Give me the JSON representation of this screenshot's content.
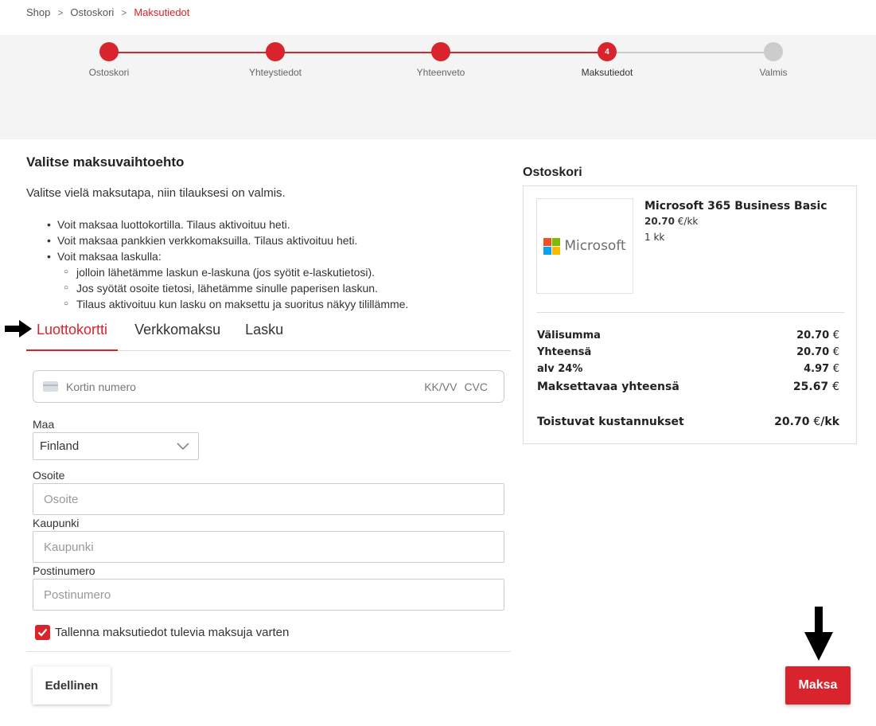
{
  "breadcrumb": {
    "items": [
      "Shop",
      "Ostoskori"
    ],
    "current": "Maksutiedot"
  },
  "colors": {
    "accent": "#d9232d",
    "inactive": "#cccccc"
  },
  "stepper": {
    "steps": [
      {
        "label": "Ostoskori",
        "state": "done"
      },
      {
        "label": "Yhteystiedot",
        "state": "done"
      },
      {
        "label": "Yhteenveto",
        "state": "done"
      },
      {
        "label": "Maksutiedot",
        "state": "current",
        "number": "4"
      },
      {
        "label": "Valmis",
        "state": "todo"
      }
    ]
  },
  "main": {
    "title": "Valitse maksuvaihtoehto",
    "intro": "Valitse vielä maksutapa, niin tilauksesi on valmis.",
    "bullets": [
      "Voit maksaa luottokortilla. Tilaus aktivoituu heti.",
      "Voit maksaa pankkien verkkomaksuilla. Tilaus aktivoituu heti.",
      "Voit maksaa laskulla:"
    ],
    "sub_bullets": [
      "jolloin lähetämme laskun e-laskuna (jos syötit e-laskutietosi).",
      "Jos syötät osoite tietosi, lähetämme sinulle paperisen laskun.",
      "Tilaus aktivoituu kun lasku on maksettu ja suoritus näkyy tilillämme."
    ],
    "tabs": [
      "Luottokortti",
      "Verkkomaksu",
      "Lasku"
    ],
    "active_tab": 0
  },
  "form": {
    "card_placeholder": "Kortin numero",
    "expiry_placeholder": "KK/VV",
    "cvc_placeholder": "CVC",
    "country_label": "Maa",
    "country_value": "Finland",
    "address_label": "Osoite",
    "address_placeholder": "Osoite",
    "city_label": "Kaupunki",
    "city_placeholder": "Kaupunki",
    "zip_label": "Postinumero",
    "zip_placeholder": "Postinumero",
    "save_label": "Tallenna maksutiedot tulevia maksuja varten",
    "save_checked": true
  },
  "actions": {
    "prev_label": "Edellinen",
    "pay_label": "Maksa"
  },
  "cart": {
    "title": "Ostoskori",
    "product_logo_text": "Microsoft",
    "product_name": "Microsoft 365 Business Basic",
    "product_price": "20.70",
    "product_price_unit": "€/kk",
    "product_qty": "1 kk",
    "totals": [
      {
        "label": "Välisumma",
        "value": "20.70",
        "unit": "€"
      },
      {
        "label": "Yhteensä",
        "value": "20.70",
        "unit": "€"
      },
      {
        "label": "alv 24%",
        "value": "4.97",
        "unit": "€"
      },
      {
        "label": "Maksettavaa yhteensä",
        "value": "25.67",
        "unit": "€"
      }
    ],
    "recurring_label": "Toistuvat kustannukset",
    "recurring_value": "20.70",
    "recurring_unit": "€",
    "recurring_suffix": "/kk"
  }
}
